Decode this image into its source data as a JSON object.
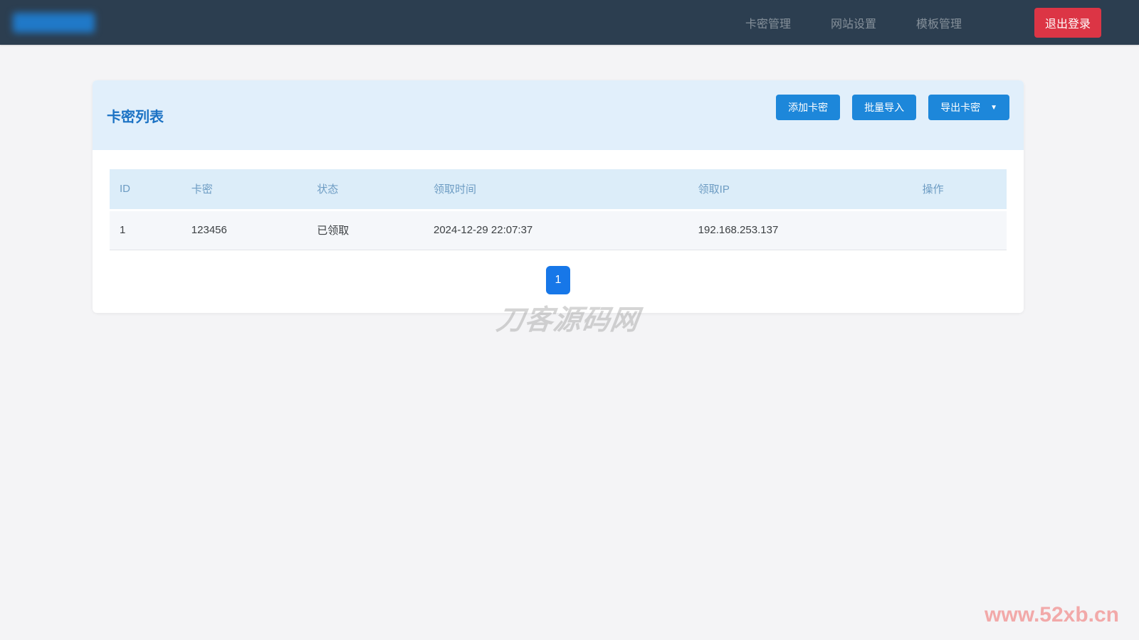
{
  "navbar": {
    "items": [
      {
        "label": "卡密管理"
      },
      {
        "label": "网站设置"
      },
      {
        "label": "模板管理"
      }
    ],
    "logout_label": "退出登录"
  },
  "panel": {
    "title": "卡密列表",
    "buttons": {
      "add": "添加卡密",
      "batch_import": "批量导入",
      "export": "导出卡密",
      "export_caret": "▼"
    }
  },
  "table": {
    "headers": [
      "ID",
      "卡密",
      "状态",
      "领取时间",
      "领取IP",
      "操作"
    ],
    "rows": [
      {
        "id": "1",
        "key": "123456",
        "status": "已领取",
        "claim_time": "2024-12-29 22:07:37",
        "claim_ip": "192.168.253.137",
        "actions": ""
      }
    ]
  },
  "pagination": {
    "active_page": "1"
  },
  "watermarks": {
    "center": "刀客源码网",
    "bottom_right": "www.52xb.cn"
  },
  "colors": {
    "navbar_bg": "#2c3e50",
    "accent_blue": "#1d87da",
    "title_blue": "#1b72c4",
    "danger_red": "#dc3545",
    "card_header_bg": "#e1effb",
    "table_header_bg": "#dcedf9",
    "table_header_text": "#6d9cc3",
    "row_bg": "#f5f7fa",
    "pagination_active_bg": "#1777e8",
    "page_bg": "#f4f4f6"
  }
}
